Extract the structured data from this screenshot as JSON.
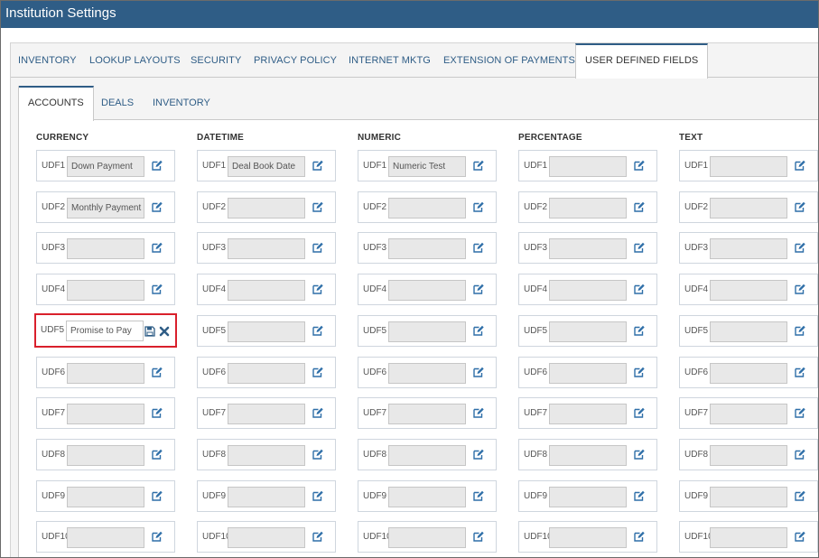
{
  "window": {
    "title": "Institution Settings"
  },
  "main_tabs": [
    {
      "label": "INVENTORY"
    },
    {
      "label": "LOOKUP LAYOUTS"
    },
    {
      "label": "SECURITY"
    },
    {
      "label": "PRIVACY POLICY"
    },
    {
      "label": "INTERNET MKTG"
    },
    {
      "label": "EXTENSION OF PAYMENTS"
    },
    {
      "label": "USER DEFINED FIELDS",
      "active": true
    }
  ],
  "sub_tabs": [
    {
      "label": "ACCOUNTS",
      "active": true
    },
    {
      "label": "DEALS"
    },
    {
      "label": "INVENTORY"
    }
  ],
  "columns": [
    {
      "header": "CURRENCY",
      "fields": [
        {
          "label": "UDF1",
          "value": "Down Payment"
        },
        {
          "label": "UDF2",
          "value": "Monthly Payment"
        },
        {
          "label": "UDF3",
          "value": ""
        },
        {
          "label": "UDF4",
          "value": ""
        },
        {
          "label": "UDF5",
          "value": "Promise to Pay",
          "editing": true
        },
        {
          "label": "UDF6",
          "value": ""
        },
        {
          "label": "UDF7",
          "value": ""
        },
        {
          "label": "UDF8",
          "value": ""
        },
        {
          "label": "UDF9",
          "value": ""
        },
        {
          "label": "UDF10",
          "value": ""
        }
      ]
    },
    {
      "header": "DATETIME",
      "fields": [
        {
          "label": "UDF1",
          "value": "Deal Book Date"
        },
        {
          "label": "UDF2",
          "value": ""
        },
        {
          "label": "UDF3",
          "value": ""
        },
        {
          "label": "UDF4",
          "value": ""
        },
        {
          "label": "UDF5",
          "value": ""
        },
        {
          "label": "UDF6",
          "value": ""
        },
        {
          "label": "UDF7",
          "value": ""
        },
        {
          "label": "UDF8",
          "value": ""
        },
        {
          "label": "UDF9",
          "value": ""
        },
        {
          "label": "UDF10",
          "value": ""
        }
      ]
    },
    {
      "header": "NUMERIC",
      "fields": [
        {
          "label": "UDF1",
          "value": "Numeric Test"
        },
        {
          "label": "UDF2",
          "value": ""
        },
        {
          "label": "UDF3",
          "value": ""
        },
        {
          "label": "UDF4",
          "value": ""
        },
        {
          "label": "UDF5",
          "value": ""
        },
        {
          "label": "UDF6",
          "value": ""
        },
        {
          "label": "UDF7",
          "value": ""
        },
        {
          "label": "UDF8",
          "value": ""
        },
        {
          "label": "UDF9",
          "value": ""
        },
        {
          "label": "UDF10",
          "value": ""
        }
      ]
    },
    {
      "header": "PERCENTAGE",
      "fields": [
        {
          "label": "UDF1",
          "value": ""
        },
        {
          "label": "UDF2",
          "value": ""
        },
        {
          "label": "UDF3",
          "value": ""
        },
        {
          "label": "UDF4",
          "value": ""
        },
        {
          "label": "UDF5",
          "value": ""
        },
        {
          "label": "UDF6",
          "value": ""
        },
        {
          "label": "UDF7",
          "value": ""
        },
        {
          "label": "UDF8",
          "value": ""
        },
        {
          "label": "UDF9",
          "value": ""
        },
        {
          "label": "UDF10",
          "value": ""
        }
      ]
    },
    {
      "header": "TEXT",
      "fields": [
        {
          "label": "UDF1",
          "value": ""
        },
        {
          "label": "UDF2",
          "value": ""
        },
        {
          "label": "UDF3",
          "value": ""
        },
        {
          "label": "UDF4",
          "value": ""
        },
        {
          "label": "UDF5",
          "value": ""
        },
        {
          "label": "UDF6",
          "value": ""
        },
        {
          "label": "UDF7",
          "value": ""
        },
        {
          "label": "UDF8",
          "value": ""
        },
        {
          "label": "UDF9",
          "value": ""
        },
        {
          "label": "UDF10",
          "value": ""
        }
      ]
    }
  ],
  "icons": {
    "edit": "edit-icon",
    "save": "save-icon",
    "cancel": "close-icon"
  },
  "colors": {
    "accent": "#2f5d86",
    "highlight": "#d9202c"
  }
}
